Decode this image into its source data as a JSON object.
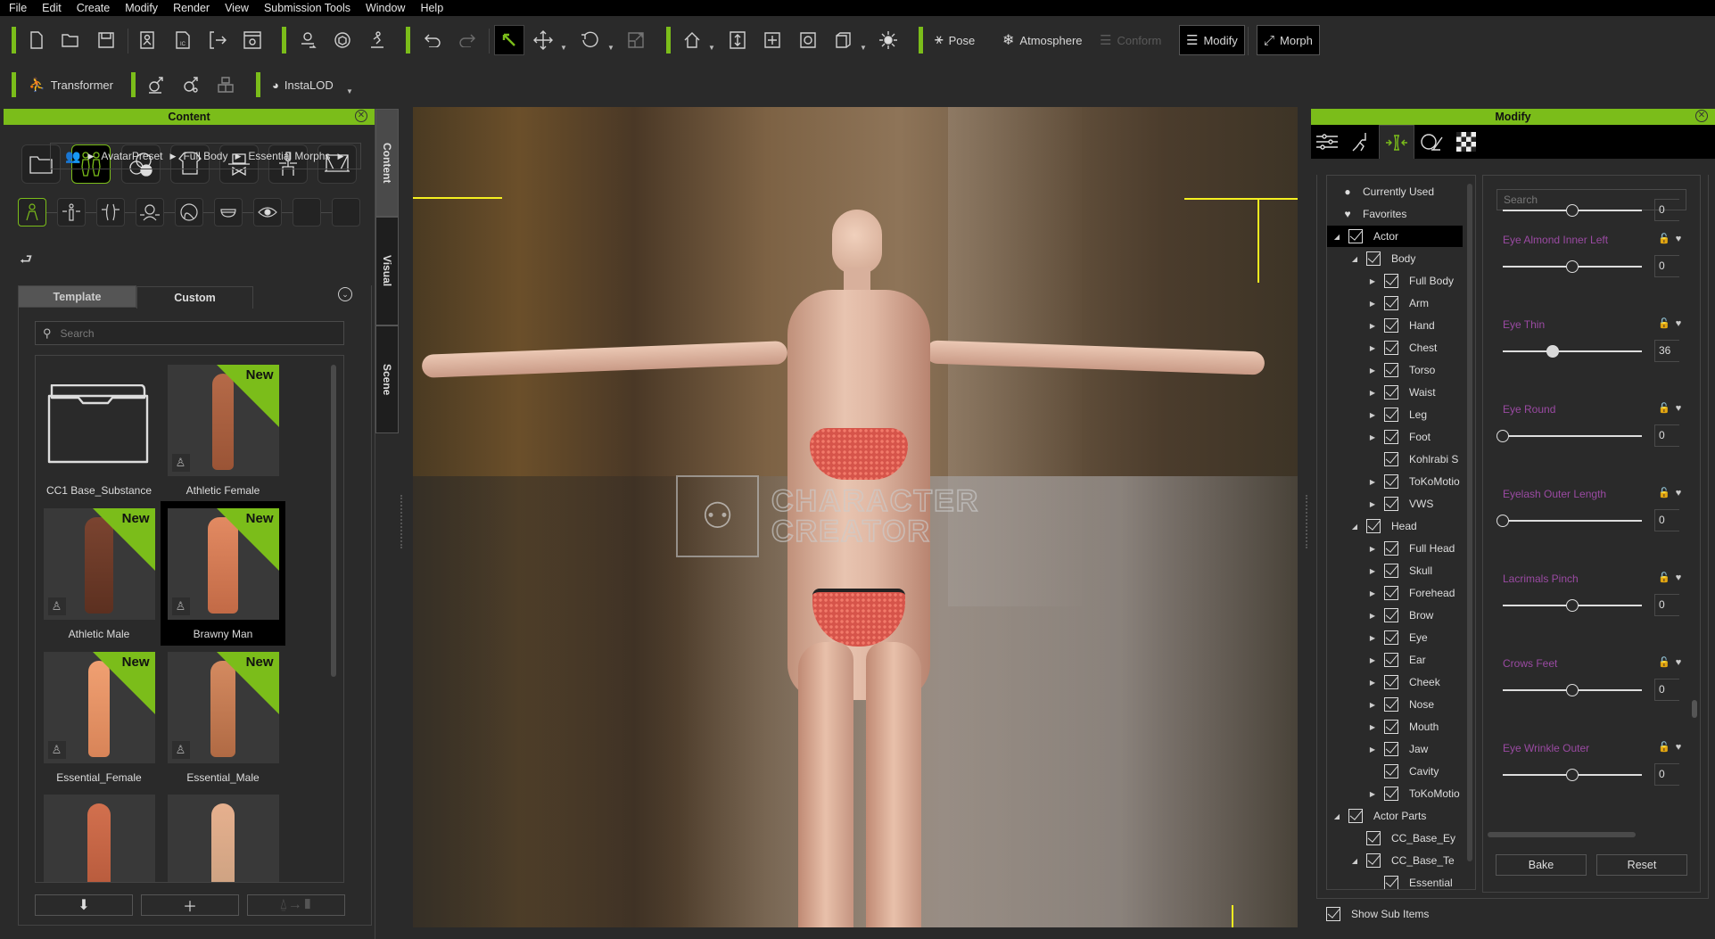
{
  "menu": [
    "File",
    "Edit",
    "Create",
    "Modify",
    "Render",
    "View",
    "Submission Tools",
    "Window",
    "Help"
  ],
  "toolbar": {
    "pose_label": "Pose",
    "atmosphere_label": "Atmosphere",
    "conform_label": "Conform",
    "modify_label": "Modify",
    "morph_label": "Morph",
    "transformer_label": "Transformer",
    "instalod_label": "InstaLOD"
  },
  "content_panel": {
    "title": "Content",
    "breadcrumb": [
      "AvatarPreset",
      "Full Body",
      "Essential Morphs"
    ],
    "tabs": {
      "template": "Template",
      "custom": "Custom"
    },
    "search_placeholder": "Search",
    "new_badge": "New",
    "items": [
      {
        "label": "CC1 Base_Substance",
        "type": "folder"
      },
      {
        "label": "Athletic Female",
        "new": true
      },
      {
        "label": "Athletic Male",
        "new": true
      },
      {
        "label": "Brawny Man",
        "new": true,
        "selected": true
      },
      {
        "label": "Essential_Female",
        "new": true
      },
      {
        "label": "Essential_Male",
        "new": true
      },
      {
        "label": ""
      },
      {
        "label": ""
      }
    ]
  },
  "side_tabs": [
    "Content",
    "Visual",
    "Scene"
  ],
  "viewport": {
    "watermark_line1": "CHARACTER",
    "watermark_line2": "CREATOR"
  },
  "modify_panel": {
    "title": "Modify",
    "tree": [
      {
        "label": "Currently Used",
        "level": 0,
        "icon": "dot"
      },
      {
        "label": "Favorites",
        "level": 0,
        "icon": "heart"
      },
      {
        "label": "Actor",
        "level": 0,
        "expand": "open",
        "selected": true
      },
      {
        "label": "Body",
        "level": 1,
        "expand": "open"
      },
      {
        "label": "Full Body",
        "level": 2,
        "expand": "closed"
      },
      {
        "label": "Arm",
        "level": 2,
        "expand": "closed"
      },
      {
        "label": "Hand",
        "level": 2,
        "expand": "closed"
      },
      {
        "label": "Chest",
        "level": 2,
        "expand": "closed"
      },
      {
        "label": "Torso",
        "level": 2,
        "expand": "closed"
      },
      {
        "label": "Waist",
        "level": 2,
        "expand": "closed"
      },
      {
        "label": "Leg",
        "level": 2,
        "expand": "closed"
      },
      {
        "label": "Foot",
        "level": 2,
        "expand": "closed"
      },
      {
        "label": "Kohlrabi S",
        "level": 2,
        "expand": "none"
      },
      {
        "label": "ToKoMotio",
        "level": 2,
        "expand": "closed"
      },
      {
        "label": "VWS",
        "level": 2,
        "expand": "closed"
      },
      {
        "label": "Head",
        "level": 1,
        "expand": "open"
      },
      {
        "label": "Full Head",
        "level": 2,
        "expand": "closed"
      },
      {
        "label": "Skull",
        "level": 2,
        "expand": "closed"
      },
      {
        "label": "Forehead",
        "level": 2,
        "expand": "closed"
      },
      {
        "label": "Brow",
        "level": 2,
        "expand": "closed"
      },
      {
        "label": "Eye",
        "level": 2,
        "expand": "closed"
      },
      {
        "label": "Ear",
        "level": 2,
        "expand": "closed"
      },
      {
        "label": "Cheek",
        "level": 2,
        "expand": "closed"
      },
      {
        "label": "Nose",
        "level": 2,
        "expand": "closed"
      },
      {
        "label": "Mouth",
        "level": 2,
        "expand": "closed"
      },
      {
        "label": "Jaw",
        "level": 2,
        "expand": "closed"
      },
      {
        "label": "Cavity",
        "level": 2,
        "expand": "none"
      },
      {
        "label": "ToKoMotio",
        "level": 2,
        "expand": "closed"
      },
      {
        "label": "Actor Parts",
        "level": 0,
        "expand": "open"
      },
      {
        "label": "CC_Base_Ey",
        "level": 1,
        "expand": "none"
      },
      {
        "label": "CC_Base_Te",
        "level": 1,
        "expand": "open"
      },
      {
        "label": "Essential",
        "level": 2,
        "expand": "none"
      }
    ],
    "search_placeholder": "Search",
    "sliders": [
      {
        "name": "",
        "value": "0",
        "fraction": 0.5
      },
      {
        "name": "Eye Almond Inner Left",
        "value": "0",
        "fraction": 0.5
      },
      {
        "name": "Eye Thin",
        "value": "36",
        "fraction": 0.36,
        "filled": true
      },
      {
        "name": "Eye Round",
        "value": "0",
        "fraction": 0.0
      },
      {
        "name": "Eyelash Outer Length",
        "value": "0",
        "fraction": 0.0
      },
      {
        "name": "Lacrimals Pinch",
        "value": "0",
        "fraction": 0.5
      },
      {
        "name": "Crows Feet",
        "value": "0",
        "fraction": 0.5
      },
      {
        "name": "Eye Wrinkle Outer",
        "value": "0",
        "fraction": 0.5
      }
    ],
    "bake_label": "Bake",
    "reset_label": "Reset",
    "show_sub_items_label": "Show Sub Items",
    "show_sub_items_checked": true
  },
  "colors": {
    "accent": "#7bbd1a",
    "slider_label": "#9a4aa2"
  }
}
